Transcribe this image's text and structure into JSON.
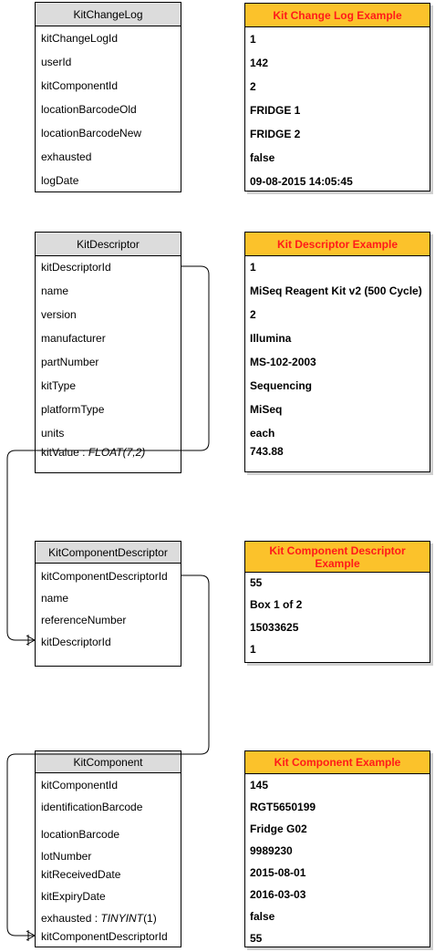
{
  "entities": {
    "kit_change_log": {
      "title": "KitChangeLog",
      "fields": [
        "kitChangeLogId",
        "userId",
        "kitComponentId",
        "locationBarcodeOld",
        "locationBarcodeNew",
        "exhausted",
        "logDate"
      ]
    },
    "kit_descriptor": {
      "title": "KitDescriptor",
      "fields": [
        "kitDescriptorId",
        "name",
        "version",
        "manufacturer",
        "partNumber",
        "kitType",
        "platformType",
        "units"
      ],
      "typed_field": {
        "name": "kitValue : ",
        "type": "FLOAT(7,2)"
      }
    },
    "kit_component_descriptor": {
      "title": "KitComponentDescriptor",
      "fields": [
        "kitComponentDescriptorId",
        "name",
        "referenceNumber",
        "kitDescriptorId"
      ]
    },
    "kit_component": {
      "title": "KitComponent",
      "fields": [
        "kitComponentId",
        "identificationBarcode",
        "locationBarcode",
        "lotNumber",
        "kitReceivedDate",
        "kitExpiryDate"
      ],
      "typed_field": {
        "name": "exhausted : ",
        "type": "TINYINT",
        "suffix": "(1)"
      },
      "last_field": "kitComponentDescriptorId"
    }
  },
  "examples": {
    "kit_change_log": {
      "title": "Kit Change Log Example",
      "values": [
        "1",
        "142",
        "2",
        "FRIDGE 1",
        "FRIDGE 2",
        "false",
        "09-08-2015 14:05:45"
      ]
    },
    "kit_descriptor": {
      "title": "Kit Descriptor Example",
      "values": [
        "1",
        "MiSeq Reagent Kit v2 (500 Cycle)",
        "2",
        "Illumina",
        "MS-102-2003",
        "Sequencing",
        "MiSeq",
        "each",
        "743.88"
      ]
    },
    "kit_component_descriptor": {
      "title": "Kit Component Descriptor Example",
      "values": [
        "55",
        "Box 1 of 2",
        "15033625",
        "1"
      ]
    },
    "kit_component": {
      "title": "Kit Component Example",
      "values": [
        "145",
        "RGT5650199",
        "Fridge G02",
        "9989230",
        "2015-08-01",
        "2016-03-03",
        "false",
        "55"
      ]
    }
  },
  "colors": {
    "entity_header": "#dcdcdc",
    "example_header": "#fbc22b",
    "example_title": "#ff1a1a",
    "border": "#000000"
  }
}
